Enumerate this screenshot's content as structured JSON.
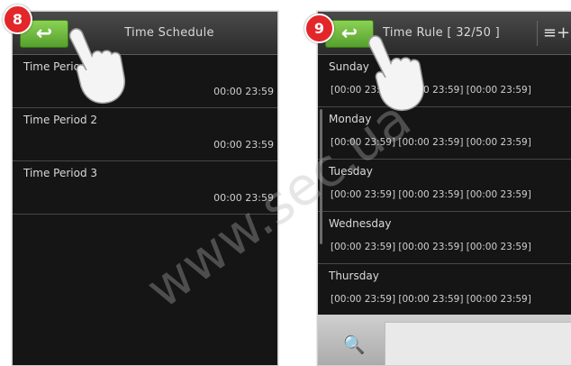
{
  "steps": {
    "left": "8",
    "right": "9"
  },
  "left_screen": {
    "back_label": "↩",
    "title": "Time Schedule",
    "periods": [
      {
        "label": "Time Period 1",
        "time": "00:00  23:59"
      },
      {
        "label": "Time Period 2",
        "time": "00:00  23:59"
      },
      {
        "label": "Time Period 3",
        "time": "00:00  23:59"
      }
    ]
  },
  "right_screen": {
    "back_label": "↩",
    "title": "Time Rule [ 32/50 ]",
    "menu_icon": "≡+",
    "days": [
      {
        "label": "Sunday",
        "times": "[00:00 23:59]  [00:00 23:59]  [00:00 23:59]"
      },
      {
        "label": "Monday",
        "times": "[00:00 23:59]  [00:00 23:59]  [00:00 23:59]"
      },
      {
        "label": "Tuesday",
        "times": "[00:00 23:59]  [00:00 23:59]  [00:00 23:59]"
      },
      {
        "label": "Wednesday",
        "times": "[00:00 23:59]  [00:00 23:59]  [00:00 23:59]"
      },
      {
        "label": "Thursday",
        "times": "[00:00 23:59]  [00:00 23:59]  [00:00 23:59]"
      }
    ],
    "search_icon": "🔍",
    "search_value": ""
  },
  "watermark": "www.sec.ua",
  "colors": {
    "accent_green": "#6cbf3a",
    "badge_red": "#e2262a",
    "panel_bg": "#151515"
  }
}
